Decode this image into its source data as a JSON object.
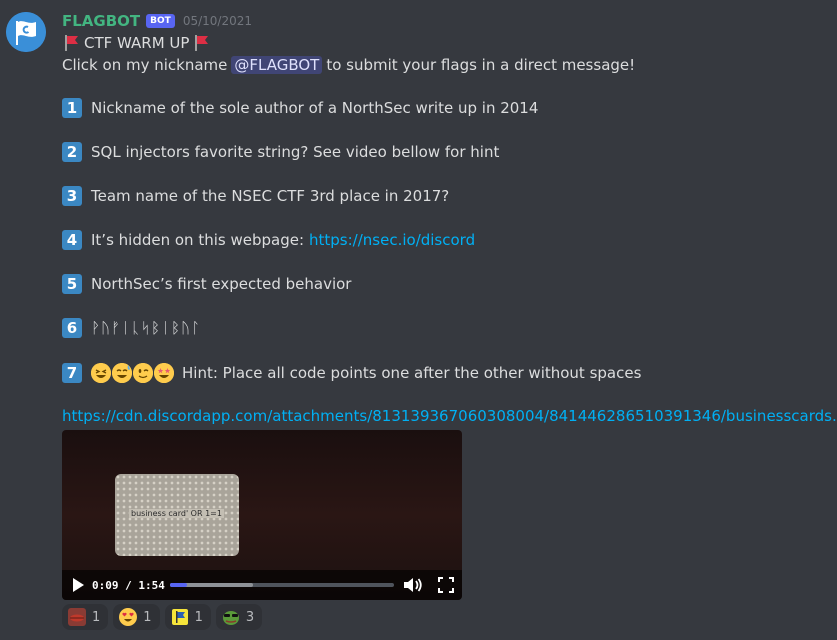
{
  "author": {
    "name": "FLAGBOT",
    "tag": "BOT",
    "timestamp": "05/10/2021"
  },
  "title": {
    "left_emoji": "triangular-flag-icon",
    "text": "CTF WARM UP",
    "right_emoji": "triangular-flag-icon"
  },
  "intro": {
    "before": "Click on my nickname",
    "mention": "@FLAGBOT",
    "after": "to submit your flags in a direct message!"
  },
  "questions": [
    {
      "num": "1",
      "text": "Nickname of the sole author of a NorthSec write up in 2014"
    },
    {
      "num": "2",
      "text": "SQL injectors favorite string? See video bellow for hint"
    },
    {
      "num": "3",
      "text": "Team name of the NSEC CTF 3rd place in 2017?"
    },
    {
      "num": "4",
      "text": "It’s hidden on this webpage:",
      "link": "https://nsec.io/discord"
    },
    {
      "num": "5",
      "text": "NorthSec’s first expected behavior"
    },
    {
      "num": "6",
      "text": "ᚹᚢᚠᛁᚳᛋᛒᛁᛒᚢᛚ"
    },
    {
      "num": "7",
      "emojis": [
        "grinning-squinting-face-icon",
        "grinning-sweat-face-icon",
        "winking-face-icon",
        "star-struck-face-icon"
      ],
      "text": "Hint: Place all code points one after the other without spaces"
    }
  ],
  "attachment_link": "https://cdn.discordapp.com/attachments/813139367060308004/841446286510391346/businesscards.mp4",
  "video": {
    "card_text": "business card' OR 1=1",
    "time": "0:09 / 1:54",
    "progress": 0.078,
    "buffered": 0.37
  },
  "reactions": [
    {
      "emoji": "lips-icon",
      "count": "1"
    },
    {
      "emoji": "heart-eyes-icon",
      "count": "1"
    },
    {
      "emoji": "flag-sticker-icon",
      "count": "1"
    },
    {
      "emoji": "pepe-sunglasses-icon",
      "count": "3"
    }
  ],
  "colors": {
    "background": "#36393f",
    "username": "#43b581",
    "link": "#00b0f4",
    "keycap": "#3b88c3",
    "progress": "#5865f2"
  }
}
